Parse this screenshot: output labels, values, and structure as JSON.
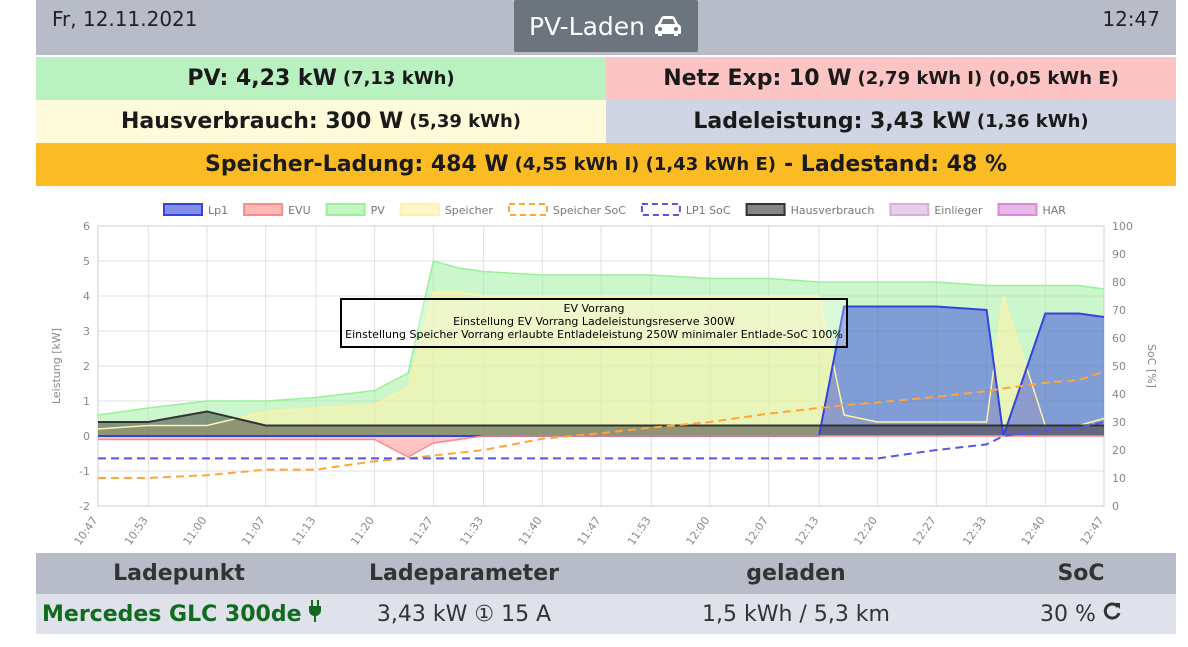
{
  "header": {
    "date": "Fr, 12.11.2021",
    "title": "PV-Laden",
    "time": "12:47",
    "title_icon": "car-icon"
  },
  "tiles": {
    "pv": {
      "label": "PV: 4,23 kW",
      "detail": "(7,13 kWh)",
      "color": "#b9f2c0"
    },
    "netz": {
      "label": "Netz Exp: 10 W",
      "detail": "(2,79 kWh I) (0,05 kWh E)",
      "color": "#fdc4c4"
    },
    "haus": {
      "label": "Hausverbrauch: 300 W",
      "detail": "(5,39 kWh)",
      "color": "#fdfbd9"
    },
    "ladeleistung": {
      "label": "Ladeleistung: 3,43 kW",
      "detail": "(1,36 kWh)",
      "color": "#d0d5e3"
    },
    "speicher": {
      "label": "Speicher-Ladung: 484 W",
      "detail": "(4,55 kWh I) (1,43 kWh E)",
      "suffix": "- Ladestand: 48 %",
      "color": "#fbbb24"
    }
  },
  "chart_data": {
    "type": "line",
    "title": "",
    "xlabel": "",
    "ylabel": "Leistung [kW]",
    "y2label": "SoC [%]",
    "ylim": [
      -2,
      6
    ],
    "y2lim": [
      0,
      100
    ],
    "yticks": [
      "6",
      "5",
      "4",
      "3",
      "2",
      "1",
      "0",
      "-1",
      "-2"
    ],
    "y2ticks": [
      "100",
      "90",
      "80",
      "70",
      "60",
      "50",
      "40",
      "30",
      "20",
      "10",
      "0"
    ],
    "xticks": [
      "10:47",
      "10:53",
      "11:00",
      "11:07",
      "11:13",
      "11:20",
      "11:27",
      "11:33",
      "11:40",
      "11:47",
      "11:53",
      "12:00",
      "12:07",
      "12:13",
      "12:20",
      "12:27",
      "12:33",
      "12:40",
      "12:47"
    ],
    "x": [
      "10:47",
      "10:53",
      "11:00",
      "11:07",
      "11:13",
      "11:20",
      "11:24",
      "11:27",
      "11:30",
      "11:33",
      "11:40",
      "11:47",
      "11:53",
      "12:00",
      "12:07",
      "12:13",
      "12:16",
      "12:20",
      "12:27",
      "12:33",
      "12:35",
      "12:40",
      "12:44",
      "12:47"
    ],
    "legend_position": "top",
    "legend": [
      {
        "name": "Lp1",
        "color": "#3344dd",
        "style": "fill"
      },
      {
        "name": "EVU",
        "color": "#ff8a8a",
        "style": "fill"
      },
      {
        "name": "PV",
        "color": "#9af09a",
        "style": "fill"
      },
      {
        "name": "Speicher",
        "color": "#fff2a8",
        "style": "fill"
      },
      {
        "name": "Speicher SoC",
        "color": "#ffa53a",
        "style": "dash"
      },
      {
        "name": "LP1 SoC",
        "color": "#5555ee",
        "style": "dash"
      },
      {
        "name": "Hausverbrauch",
        "color": "#333333",
        "style": "fill"
      },
      {
        "name": "Einlieger",
        "color": "#d9aed9",
        "style": "fill"
      },
      {
        "name": "HAR",
        "color": "#d98ad9",
        "style": "fill"
      }
    ],
    "series": [
      {
        "name": "PV",
        "values": [
          0.6,
          0.8,
          1.0,
          1.0,
          1.1,
          1.3,
          1.8,
          5.0,
          4.8,
          4.7,
          4.6,
          4.6,
          4.6,
          4.5,
          4.5,
          4.4,
          4.4,
          4.4,
          4.4,
          4.3,
          4.3,
          4.3,
          4.3,
          4.2
        ]
      },
      {
        "name": "Lp1",
        "values": [
          0,
          0,
          0,
          0,
          0,
          0,
          0,
          0,
          0,
          0,
          0,
          0,
          0,
          0,
          0,
          0,
          3.7,
          3.7,
          3.7,
          3.6,
          0,
          3.5,
          3.5,
          3.4
        ]
      },
      {
        "name": "Hausverbrauch",
        "values": [
          0.4,
          0.4,
          0.7,
          0.3,
          0.3,
          0.3,
          0.3,
          0.3,
          0.3,
          0.3,
          0.3,
          0.3,
          0.3,
          0.3,
          0.3,
          0.3,
          0.3,
          0.3,
          0.3,
          0.3,
          0.3,
          0.3,
          0.3,
          0.3
        ]
      },
      {
        "name": "Speicher",
        "values": [
          0.2,
          0.3,
          0.3,
          0.7,
          0.8,
          0.9,
          1.4,
          4.1,
          4.1,
          4.0,
          4.0,
          4.0,
          4.0,
          4.0,
          4.0,
          4.0,
          0.6,
          0.4,
          0.4,
          0.4,
          4.0,
          0.3,
          0.3,
          0.5
        ]
      },
      {
        "name": "EVU",
        "values": [
          -0.1,
          -0.1,
          -0.1,
          -0.1,
          -0.1,
          -0.1,
          -0.6,
          -0.2,
          -0.1,
          0,
          0,
          0,
          0,
          0,
          0,
          0,
          0,
          0,
          0,
          0,
          0,
          0,
          0,
          0
        ]
      },
      {
        "name": "Speicher SoC",
        "axis": "right",
        "values": [
          10,
          10,
          11,
          13,
          13,
          16,
          17,
          18,
          19,
          20,
          24,
          26,
          28,
          30,
          33,
          35,
          36,
          37,
          39,
          41,
          42,
          44,
          45,
          48
        ]
      },
      {
        "name": "LP1 SoC",
        "axis": "right",
        "values": [
          17,
          17,
          17,
          17,
          17,
          17,
          17,
          17,
          17,
          17,
          17,
          17,
          17,
          17,
          17,
          17,
          17,
          17,
          20,
          22,
          25,
          27,
          28,
          30
        ]
      }
    ],
    "annotation": {
      "lines": [
        "EV Vorrang",
        "Einstellung EV Vorrang  Ladeleistungsreserve 300W",
        "Einstellung Speicher Vorrang erlaubte Entladeleistung 250W minimaler Entlade-SoC 100%"
      ]
    }
  },
  "ladepunkt": {
    "headers": [
      "Ladepunkt",
      "Ladeparameter",
      "geladen",
      "SoC"
    ],
    "vehicle": "Mercedes GLC 300de",
    "vehicle_icon": "plug-icon",
    "parameter": "3,43 kW ① 15 A",
    "geladen": "1,5 kWh / 5,3 km",
    "soc": "30 %",
    "soc_icon": "refresh-icon"
  }
}
